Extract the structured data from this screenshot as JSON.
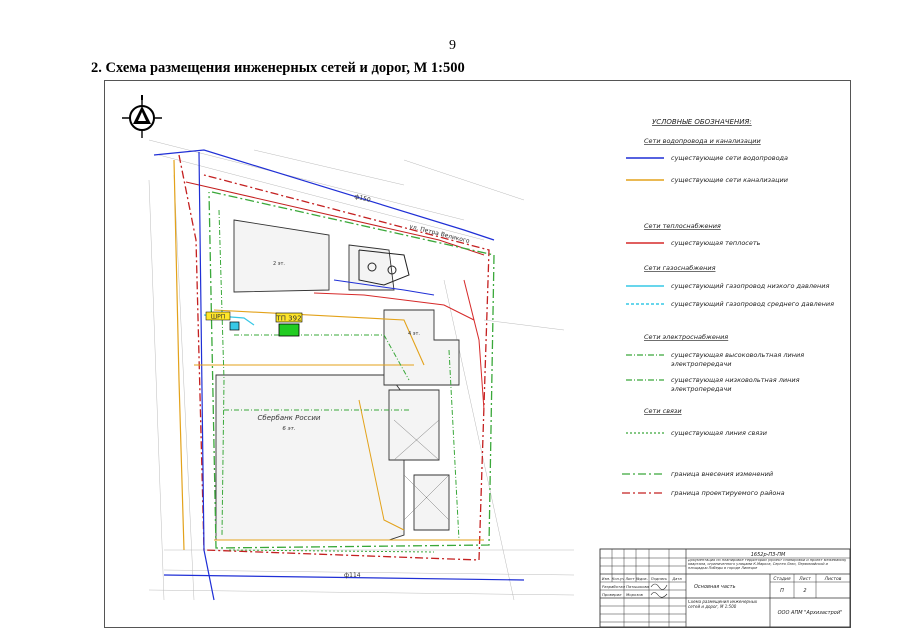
{
  "page": {
    "number": "9"
  },
  "section": {
    "heading": "2. Схема размещения инженерных сетей и дорог, М 1:500"
  },
  "plan": {
    "labels": {
      "substation": "ТП 392",
      "cabinet": "ШРП",
      "main_building": "Сбербанк России",
      "floors_main": "6 эт.",
      "pipe_top": "ф150",
      "pipe_bottom": "ф114",
      "block_label": "2 эт.",
      "block_label2": "4 эт.",
      "street": "ул. Петра Великого"
    }
  },
  "legend": {
    "title": "УСЛОВНЫЕ ОБОЗНАЧЕНИЯ:",
    "groups": [
      {
        "heading": "Сети водопровода и канализации",
        "items": [
          {
            "label": "существующие сети водопровода",
            "color": "#1f2fd6",
            "style": "solid"
          },
          {
            "label": "существующие сети канализации",
            "color": "#e3a21a",
            "style": "solid"
          }
        ]
      },
      {
        "heading": "Сети теплоснабжения",
        "items": [
          {
            "label": "существующая теплосеть",
            "color": "#d62a2a",
            "style": "solid"
          }
        ]
      },
      {
        "heading": "Сети газоснабжения",
        "items": [
          {
            "label": "существующий газопровод низкого давления",
            "color": "#37c8e6",
            "style": "solid"
          },
          {
            "label": "существующий газопровод среднего давления",
            "color": "#37c8e6",
            "style": "dashed"
          }
        ]
      },
      {
        "heading": "Сети электроснабжения",
        "items": [
          {
            "label": "существующая высоковольтная линия",
            "label2": "электропередачи",
            "color": "#3aa83a",
            "style": "dash-dot"
          },
          {
            "label": "существующая низковольтная линия",
            "label2": "электропередачи",
            "color": "#3aa83a",
            "style": "dash-dot"
          }
        ]
      },
      {
        "heading": "Сети связи",
        "items": [
          {
            "label": "существующая линия связи",
            "color": "#3aa83a",
            "style": "dot"
          }
        ]
      }
    ],
    "boundaries": [
      {
        "label": "граница внесения изменений",
        "color": "#3aa83a",
        "style": "dash-dot"
      },
      {
        "label": "граница проектируемого района",
        "color": "#c42020",
        "style": "dash-dot"
      }
    ]
  },
  "stamp": {
    "code": "1652р-ПЗ-ПМ",
    "description": "Документация по планировке территории (проект планировки и проект межевания) квартала, ограниченного улицами К.Маркса, Сергея Лазо, Первомайской и площадью Победы в городе Липецке",
    "stage_header": "Стадия",
    "sheet_header": "Лист",
    "sheets_header": "Листов",
    "stage_value": "П",
    "sheet_value": "2",
    "part_title": "Основная часть",
    "drawing_title": "Схема размещения инженерных сетей и дорог, М 1:500",
    "org": "ООО АПМ \"Архизастрой\"",
    "cols": [
      "Изм.",
      "Кол.уч",
      "Лист",
      "№док.",
      "Подпись",
      "Дата"
    ],
    "roles": [
      {
        "role": "Разработал",
        "name": "Пятышкова"
      },
      {
        "role": "Проверил",
        "name": "Морозов"
      }
    ]
  }
}
